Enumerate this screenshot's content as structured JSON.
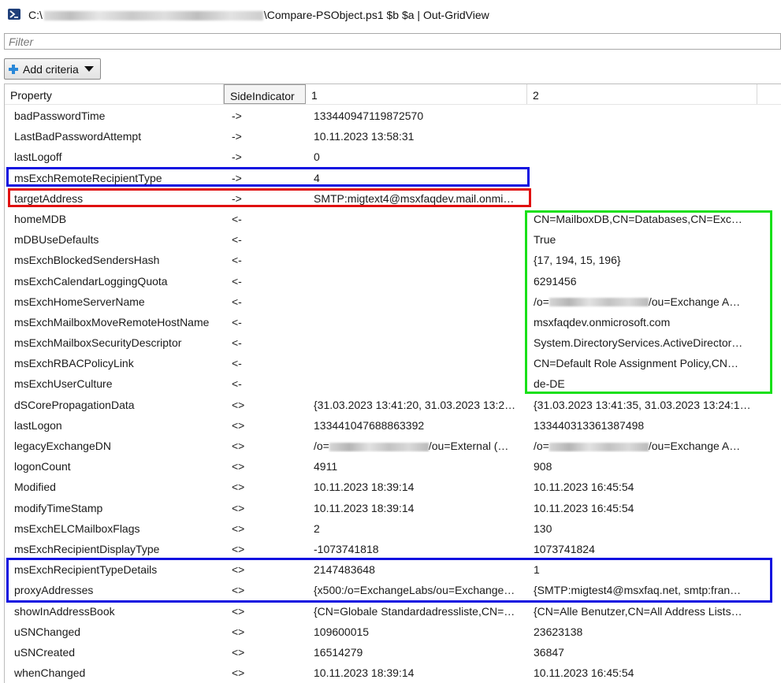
{
  "window": {
    "title_prefix": "C:\\",
    "title_suffix": "\\Compare-PSObject.ps1 $b $a | Out-GridView"
  },
  "filter": {
    "placeholder": "Filter",
    "value": ""
  },
  "toolbar": {
    "add_criteria_label": "Add criteria"
  },
  "columns": [
    "Property",
    "SideIndicator",
    "1",
    "2"
  ],
  "rows": [
    {
      "property": "badPasswordTime",
      "side": "->",
      "v1": "133440947119872570",
      "v2": ""
    },
    {
      "property": "LastBadPasswordAttempt",
      "side": "->",
      "v1": "10.11.2023 13:58:31",
      "v2": ""
    },
    {
      "property": "lastLogoff",
      "side": "->",
      "v1": "0",
      "v2": ""
    },
    {
      "property": "msExchRemoteRecipientType",
      "side": "->",
      "v1": "4",
      "v2": ""
    },
    {
      "property": "targetAddress",
      "side": "->",
      "v1": "SMTP:migtext4@msxfaqdev.mail.onmi…",
      "v2": ""
    },
    {
      "property": "homeMDB",
      "side": "<-",
      "v1": "",
      "v2": "CN=MailboxDB,CN=Databases,CN=Exc…"
    },
    {
      "property": "mDBUseDefaults",
      "side": "<-",
      "v1": "",
      "v2": "True"
    },
    {
      "property": "msExchBlockedSendersHash",
      "side": "<-",
      "v1": "",
      "v2": "{17, 194, 15, 196}"
    },
    {
      "property": "msExchCalendarLoggingQuota",
      "side": "<-",
      "v1": "",
      "v2": "6291456"
    },
    {
      "property": "msExchHomeServerName",
      "side": "<-",
      "v1": "",
      "v2": "/o=",
      "v2_tail": "/ou=Exchange A…"
    },
    {
      "property": "msExchMailboxMoveRemoteHostName",
      "side": "<-",
      "v1": "",
      "v2": "msxfaqdev.onmicrosoft.com"
    },
    {
      "property": "msExchMailboxSecurityDescriptor",
      "side": "<-",
      "v1": "",
      "v2": "System.DirectoryServices.ActiveDirector…"
    },
    {
      "property": "msExchRBACPolicyLink",
      "side": "<-",
      "v1": "",
      "v2": "CN=Default Role Assignment Policy,CN…"
    },
    {
      "property": "msExchUserCulture",
      "side": "<-",
      "v1": "",
      "v2": "de-DE"
    },
    {
      "property": "dSCorePropagationData",
      "side": "<>",
      "v1": "{31.03.2023 13:41:20, 31.03.2023 13:2…",
      "v2": "{31.03.2023 13:41:35, 31.03.2023 13:24:1…"
    },
    {
      "property": "lastLogon",
      "side": "<>",
      "v1": "133441047688863392",
      "v2": "133440313361387498"
    },
    {
      "property": "legacyExchangeDN",
      "side": "<>",
      "v1": "/o=",
      "v1_tail": "/ou=External (…",
      "v2": "/o=",
      "v2_tail": "/ou=Exchange A…"
    },
    {
      "property": "logonCount",
      "side": "<>",
      "v1": "4911",
      "v2": "908"
    },
    {
      "property": "Modified",
      "side": "<>",
      "v1": "10.11.2023 18:39:14",
      "v2": "10.11.2023 16:45:54"
    },
    {
      "property": "modifyTimeStamp",
      "side": "<>",
      "v1": "10.11.2023 18:39:14",
      "v2": "10.11.2023 16:45:54"
    },
    {
      "property": "msExchELCMailboxFlags",
      "side": "<>",
      "v1": "2",
      "v2": "130"
    },
    {
      "property": "msExchRecipientDisplayType",
      "side": "<>",
      "v1": "-1073741818",
      "v2": "1073741824"
    },
    {
      "property": "msExchRecipientTypeDetails",
      "side": "<>",
      "v1": "2147483648",
      "v2": "1"
    },
    {
      "property": "proxyAddresses",
      "side": "<>",
      "v1": "{x500:/o=ExchangeLabs/ou=Exchange…",
      "v2": "{SMTP:migtest4@msxfaq.net, smtp:fran…"
    },
    {
      "property": "showInAddressBook",
      "side": "<>",
      "v1": "{CN=Globale Standardadressliste,CN=…",
      "v2": "{CN=Alle Benutzer,CN=All Address Lists…"
    },
    {
      "property": "uSNChanged",
      "side": "<>",
      "v1": "109600015",
      "v2": "23623138"
    },
    {
      "property": "uSNCreated",
      "side": "<>",
      "v1": "16514279",
      "v2": "36847"
    },
    {
      "property": "whenChanged",
      "side": "<>",
      "v1": "10.11.2023 18:39:14",
      "v2": "10.11.2023 16:45:54"
    }
  ],
  "highlight_colors": {
    "blue": "#1010e0",
    "red": "#e01010",
    "green": "#18e018"
  }
}
